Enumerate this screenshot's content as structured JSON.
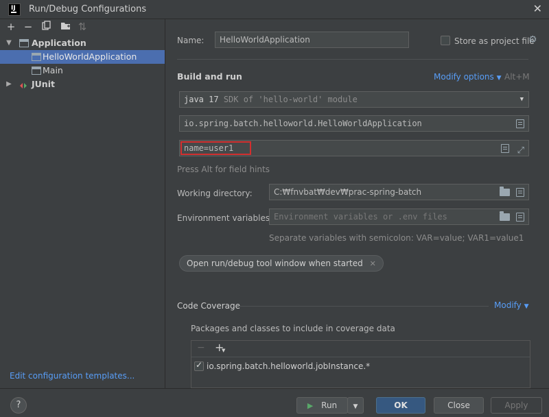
{
  "window": {
    "title": "Run/Debug Configurations",
    "app_icon_text": "IJ"
  },
  "left_toolbar": {
    "icons": [
      "add-icon",
      "remove-icon",
      "copy-icon",
      "folder-add-icon",
      "sort-icon"
    ]
  },
  "tree": {
    "items": [
      {
        "label": "Application",
        "expanded": true,
        "bold": true
      },
      {
        "label": "HelloWorldApplication",
        "selected": true
      },
      {
        "label": "Main"
      },
      {
        "label": "JUnit",
        "expanded": false,
        "bold": true
      }
    ]
  },
  "left_footer": {
    "edit_templates": "Edit configuration templates..."
  },
  "config": {
    "name_label": "Name:",
    "name_value": "HelloWorldApplication",
    "store_label": "Store as project file",
    "store_checked": false,
    "build_run_title": "Build and run",
    "modify_options": "Modify options",
    "modify_shortcut": "Alt+M",
    "jdk_name": "java 17",
    "jdk_detail": "SDK of 'hello-world' module",
    "main_class": "io.spring.batch.helloworld.HelloWorldApplication",
    "program_args": "name=user1",
    "field_hint": "Press Alt for field hints",
    "working_dir_label": "Working directory:",
    "working_dir_value": "C:₩fnvbat₩dev₩prac-spring-batch",
    "env_label": "Environment variables:",
    "env_placeholder": "Environment variables or .env files",
    "env_hint": "Separate variables with semicolon: VAR=value; VAR1=value1",
    "chip_label": "Open run/debug tool window when started",
    "coverage_title": "Code Coverage",
    "coverage_modify": "Modify",
    "coverage_sub": "Packages and classes to include in coverage data",
    "coverage_items": [
      {
        "label": "io.spring.batch.helloworld.jobInstance.*",
        "checked": true
      }
    ]
  },
  "buttons": {
    "help": "?",
    "run": "Run",
    "ok": "OK",
    "close": "Close",
    "apply": "Apply"
  },
  "colors": {
    "background": "#3c3f41",
    "selection": "#4b6eaf",
    "link": "#589df6",
    "highlight_border": "#d32f2f",
    "primary_button": "#365880",
    "run_icon": "#59a869"
  }
}
